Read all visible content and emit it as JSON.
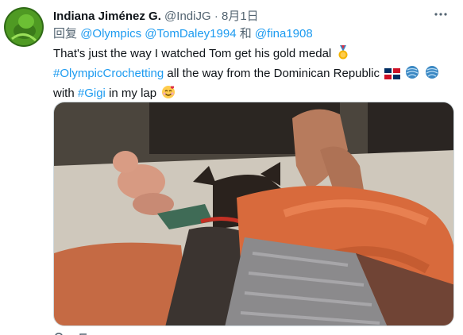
{
  "tweet": {
    "display_name": "Indiana Jiménez G.",
    "handle": "@IndiJG",
    "separator": "·",
    "date": "8月1日",
    "reply_prefix": "回复",
    "mention_1": "@Olympics",
    "mention_2": "@TomDaley1994",
    "reply_conjunction": "和",
    "mention_3": "@fina1908",
    "text_line_1": "That's just the way I watched Tom get his gold medal",
    "hashtag_1": "#OlympicCrochetting",
    "text_line_2": "all the way from the Dominican Republic",
    "text_with": "with",
    "hashtag_2": "#Gigi",
    "text_end": "in my lap"
  },
  "icons": {
    "more": "more-options-icon",
    "medal": "gold-medal-emoji",
    "flag": "dominican-flag-emoji",
    "yarn": "yarn-ball-emoji",
    "smile": "smiling-face-with-hearts-emoji"
  },
  "colors": {
    "link": "#1d9bf0",
    "secondary_text": "#536471",
    "primary_text": "#0f1419"
  }
}
